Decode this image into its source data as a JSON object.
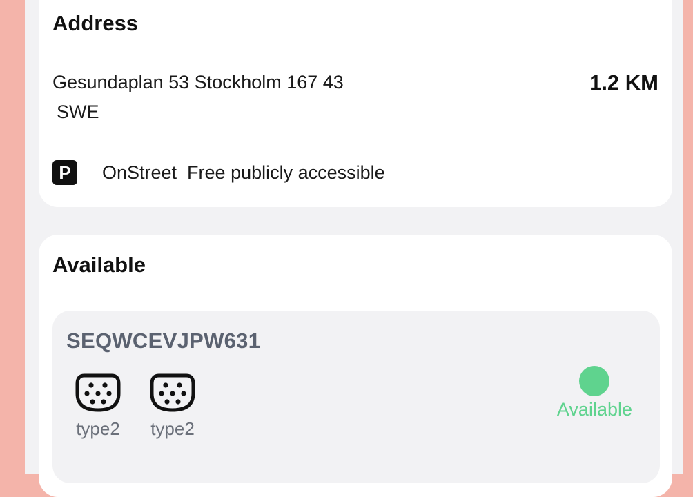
{
  "address_card": {
    "title": "Address",
    "line1": "Gesundaplan 53 Stockholm 167 43",
    "line2": "SWE",
    "distance": "1.2 KM",
    "parking_icon_letter": "P",
    "parking_icon": "parking-icon",
    "parking_text": "OnStreet  Free publicly accessible"
  },
  "available_card": {
    "title": "Available",
    "evse": {
      "id": "SEQWCEVJPW631",
      "connectors": [
        {
          "icon": "type2-connector-icon",
          "label": "type2"
        },
        {
          "icon": "type2-connector-icon",
          "label": "type2"
        }
      ],
      "status_label": "Available",
      "status_color": "#5fd38e"
    }
  }
}
